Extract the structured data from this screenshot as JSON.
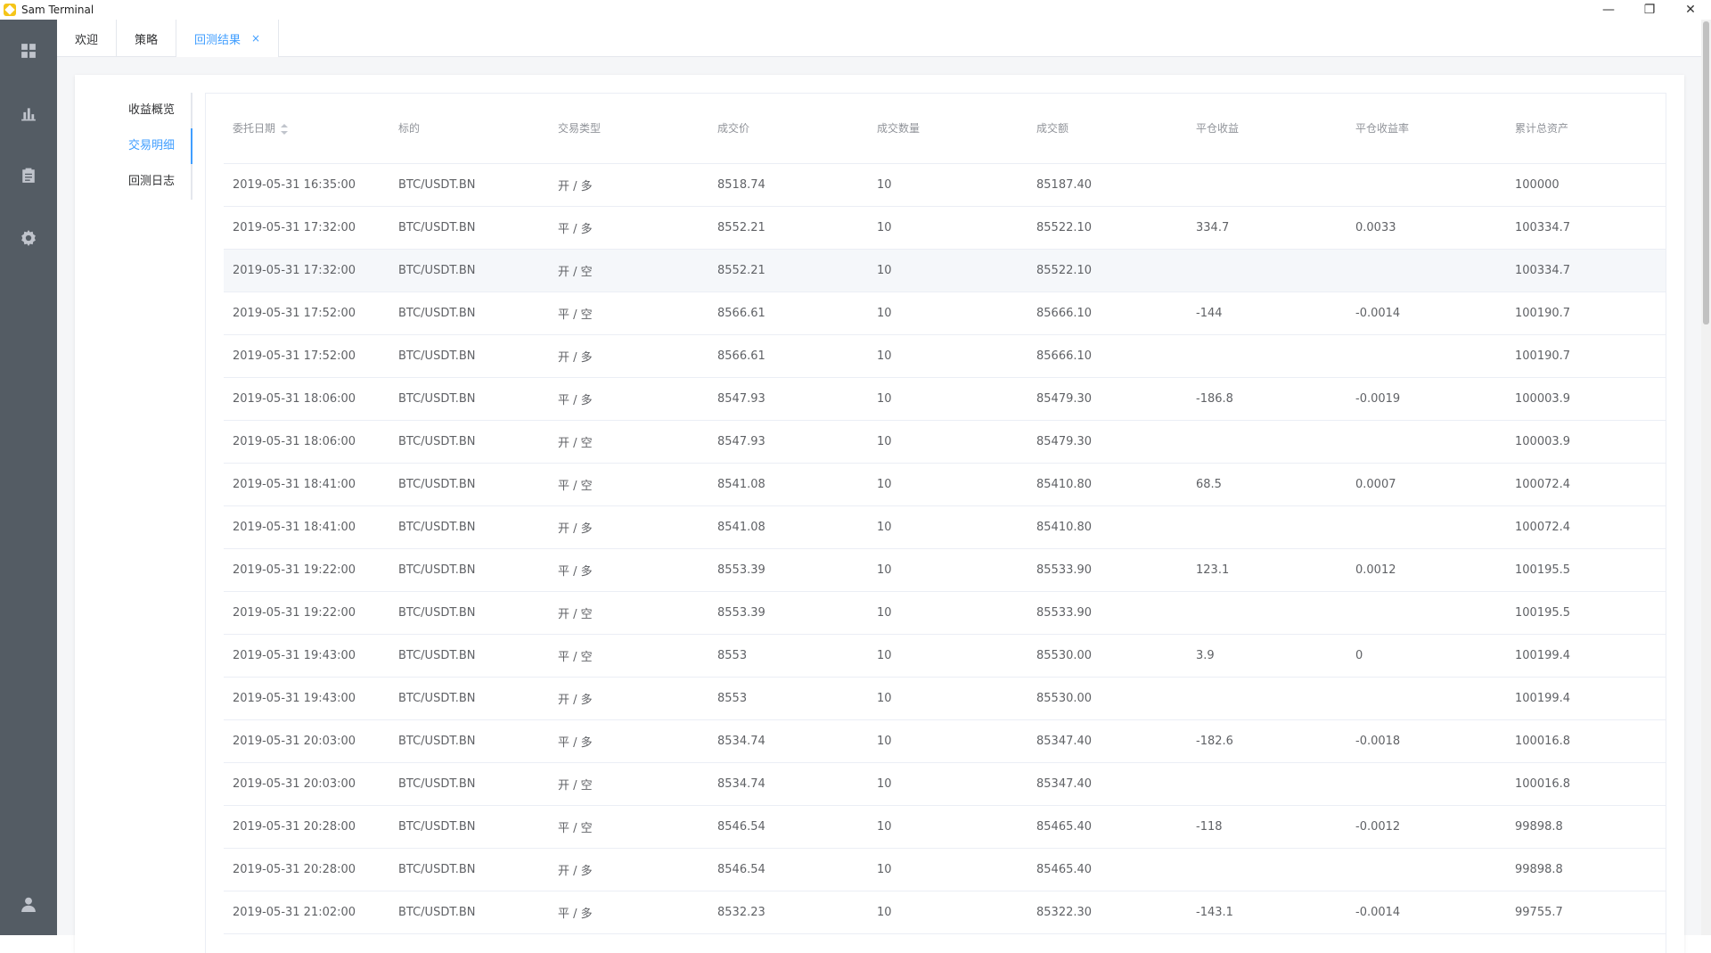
{
  "window": {
    "title": "Sam Terminal",
    "controls": {
      "minimize": "—",
      "restore": "❐",
      "close": "✕"
    }
  },
  "sidebar": {
    "icons": [
      "dashboard-icon",
      "chart-icon",
      "clipboard-icon",
      "settings-icon",
      "user-icon"
    ]
  },
  "tabs": [
    {
      "label": "欢迎",
      "active": false
    },
    {
      "label": "策略",
      "active": false
    },
    {
      "label": "回测结果",
      "active": true,
      "close": "×"
    }
  ],
  "subnav": [
    {
      "label": "收益概览",
      "active": false
    },
    {
      "label": "交易明细",
      "active": true
    },
    {
      "label": "回测日志",
      "active": false
    }
  ],
  "table": {
    "columns": [
      "委托日期",
      "标的",
      "交易类型",
      "成交价",
      "成交数量",
      "成交额",
      "平仓收益",
      "平仓收益率",
      "累计总资产"
    ],
    "rows": [
      [
        "2019-05-31 16:35:00",
        "BTC/USDT.BN",
        "开 / 多",
        "8518.74",
        "10",
        "85187.40",
        "",
        "",
        "100000"
      ],
      [
        "2019-05-31 17:32:00",
        "BTC/USDT.BN",
        "平 / 多",
        "8552.21",
        "10",
        "85522.10",
        "334.7",
        "0.0033",
        "100334.7"
      ],
      [
        "2019-05-31 17:32:00",
        "BTC/USDT.BN",
        "开 / 空",
        "8552.21",
        "10",
        "85522.10",
        "",
        "",
        "100334.7"
      ],
      [
        "2019-05-31 17:52:00",
        "BTC/USDT.BN",
        "平 / 空",
        "8566.61",
        "10",
        "85666.10",
        "-144",
        "-0.0014",
        "100190.7"
      ],
      [
        "2019-05-31 17:52:00",
        "BTC/USDT.BN",
        "开 / 多",
        "8566.61",
        "10",
        "85666.10",
        "",
        "",
        "100190.7"
      ],
      [
        "2019-05-31 18:06:00",
        "BTC/USDT.BN",
        "平 / 多",
        "8547.93",
        "10",
        "85479.30",
        "-186.8",
        "-0.0019",
        "100003.9"
      ],
      [
        "2019-05-31 18:06:00",
        "BTC/USDT.BN",
        "开 / 空",
        "8547.93",
        "10",
        "85479.30",
        "",
        "",
        "100003.9"
      ],
      [
        "2019-05-31 18:41:00",
        "BTC/USDT.BN",
        "平 / 空",
        "8541.08",
        "10",
        "85410.80",
        "68.5",
        "0.0007",
        "100072.4"
      ],
      [
        "2019-05-31 18:41:00",
        "BTC/USDT.BN",
        "开 / 多",
        "8541.08",
        "10",
        "85410.80",
        "",
        "",
        "100072.4"
      ],
      [
        "2019-05-31 19:22:00",
        "BTC/USDT.BN",
        "平 / 多",
        "8553.39",
        "10",
        "85533.90",
        "123.1",
        "0.0012",
        "100195.5"
      ],
      [
        "2019-05-31 19:22:00",
        "BTC/USDT.BN",
        "开 / 空",
        "8553.39",
        "10",
        "85533.90",
        "",
        "",
        "100195.5"
      ],
      [
        "2019-05-31 19:43:00",
        "BTC/USDT.BN",
        "平 / 空",
        "8553",
        "10",
        "85530.00",
        "3.9",
        "0",
        "100199.4"
      ],
      [
        "2019-05-31 19:43:00",
        "BTC/USDT.BN",
        "开 / 多",
        "8553",
        "10",
        "85530.00",
        "",
        "",
        "100199.4"
      ],
      [
        "2019-05-31 20:03:00",
        "BTC/USDT.BN",
        "平 / 多",
        "8534.74",
        "10",
        "85347.40",
        "-182.6",
        "-0.0018",
        "100016.8"
      ],
      [
        "2019-05-31 20:03:00",
        "BTC/USDT.BN",
        "开 / 空",
        "8534.74",
        "10",
        "85347.40",
        "",
        "",
        "100016.8"
      ],
      [
        "2019-05-31 20:28:00",
        "BTC/USDT.BN",
        "平 / 空",
        "8546.54",
        "10",
        "85465.40",
        "-118",
        "-0.0012",
        "99898.8"
      ],
      [
        "2019-05-31 20:28:00",
        "BTC/USDT.BN",
        "开 / 多",
        "8546.54",
        "10",
        "85465.40",
        "",
        "",
        "99898.8"
      ],
      [
        "2019-05-31 21:02:00",
        "BTC/USDT.BN",
        "平 / 多",
        "8532.23",
        "10",
        "85322.30",
        "-143.1",
        "-0.0014",
        "99755.7"
      ]
    ],
    "highlighted_row": 2
  },
  "colors": {
    "sidebar_bg": "#545c64",
    "accent": "#409eff",
    "text": "#606266",
    "header_text": "#909399"
  }
}
